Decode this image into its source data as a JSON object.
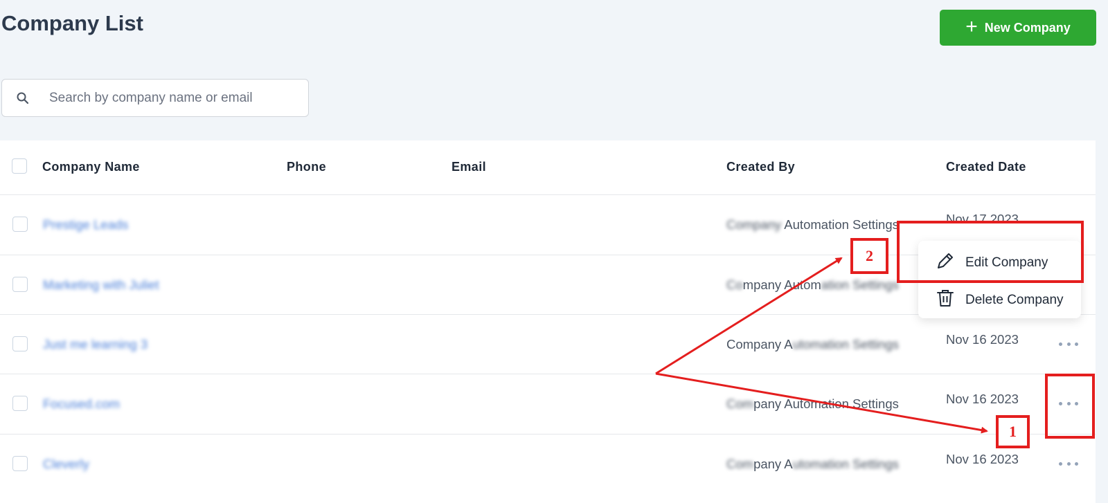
{
  "header": {
    "title": "Company List",
    "new_button_label": "New Company"
  },
  "search": {
    "placeholder": "Search by company name or email",
    "value": ""
  },
  "table": {
    "columns": [
      "Company Name",
      "Phone",
      "Email",
      "Created By",
      "Created Date"
    ],
    "rows": [
      {
        "name": "Prestige Leads",
        "phone": "",
        "email": "",
        "created_by": "Company Automation Settings",
        "created_date": "Nov 17 2023"
      },
      {
        "name": "Marketing with Juliet",
        "phone": "",
        "email": "",
        "created_by": "Company Automation Settings",
        "created_date": ""
      },
      {
        "name": "Just me learning 3",
        "phone": "",
        "email": "",
        "created_by": "Company Automation Settings",
        "created_date": "Nov 16 2023"
      },
      {
        "name": "Focused.com",
        "phone": "",
        "email": "",
        "created_by": "Company Automation Settings",
        "created_date": "Nov 16 2023"
      },
      {
        "name": "Cleverly",
        "phone": "",
        "email": "",
        "created_by": "Company Automation Settings",
        "created_date": "Nov 16 2023"
      }
    ]
  },
  "context_menu": {
    "edit_label": "Edit Company",
    "delete_label": "Delete Company"
  },
  "annotations": {
    "step1": "1",
    "step2": "2",
    "color": "#e41e1e"
  },
  "colors": {
    "accent_green": "#2ea832",
    "link_blue": "#4a7fd9",
    "background": "#f1f5f9"
  },
  "icons": {
    "search": "search-icon",
    "plus": "plus-icon",
    "edit": "pencil-icon",
    "delete": "trash-icon",
    "more": "more-horizontal-icon"
  }
}
